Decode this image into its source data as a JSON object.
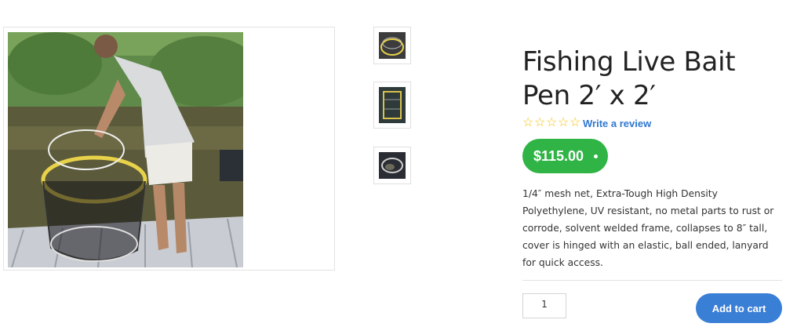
{
  "product": {
    "title_line1": "Fishing Live Bait",
    "title_line2": "Pen 2′ x 2′",
    "stars": [
      "☆",
      "☆",
      "☆",
      "☆",
      "☆"
    ],
    "rating_stars": 0,
    "review_link": "Write a review",
    "price": "$115.00",
    "description": "1/4″ mesh net, Extra-Tough High Density Polyethylene, UV resistant, no metal parts to rust or corrode, solvent welded frame, collapses to 8″ tall, cover is hinged with an elastic, ball ended, lanyard for quick access.",
    "quantity": "1",
    "add_to_cart_label": "Add to cart"
  },
  "gallery": {
    "thumbnail_count": 3
  },
  "colors": {
    "price_green": "#2fb445",
    "button_blue": "#3a7fd6",
    "star_yellow": "#f2c40f",
    "link_blue": "#2f77d1"
  }
}
